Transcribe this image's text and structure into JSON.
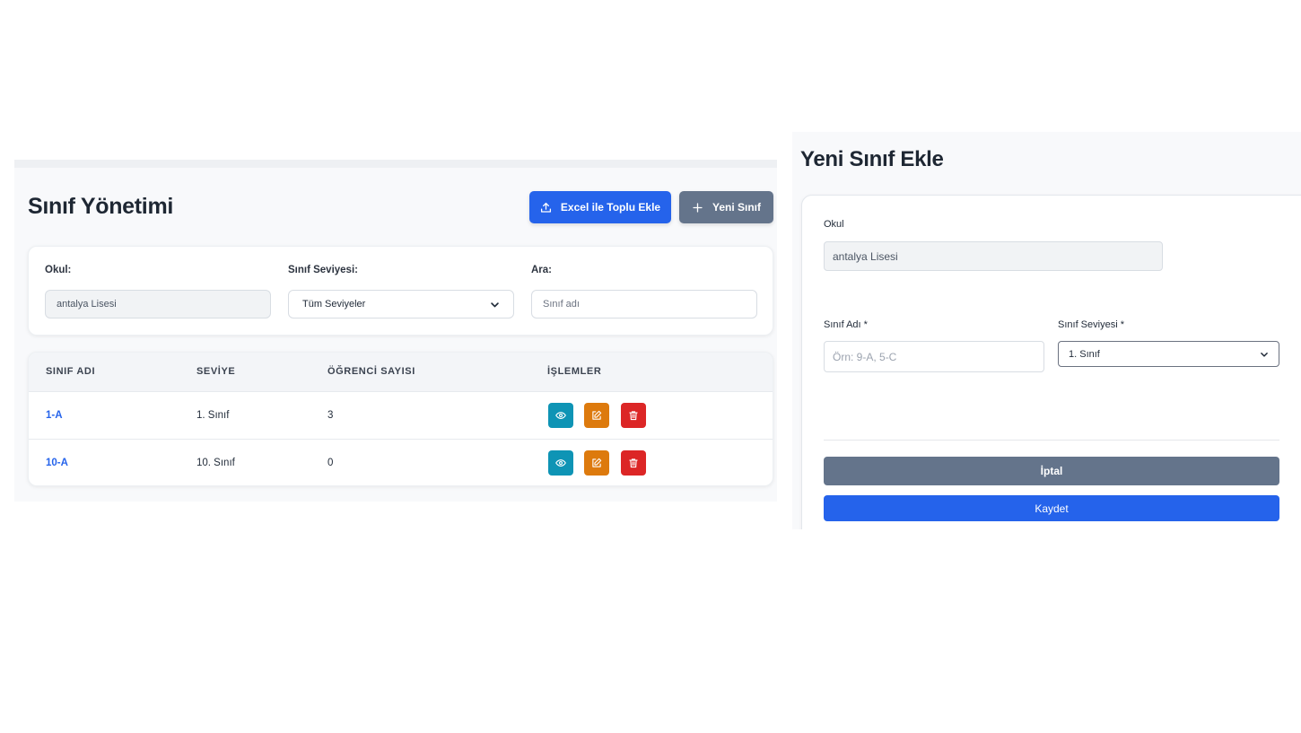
{
  "list_page": {
    "title": "Sınıf Yönetimi",
    "excel_button": "Excel ile Toplu Ekle",
    "new_button": "Yeni Sınıf",
    "filters": {
      "school_label": "Okul:",
      "school_value": "antalya Lisesi",
      "level_label": "Sınıf Seviyesi:",
      "level_value": "Tüm Seviyeler",
      "search_label": "Ara:",
      "search_placeholder": "Sınıf adı"
    },
    "table": {
      "headers": [
        "SINIF ADI",
        "SEVİYE",
        "ÖĞRENCİ SAYISI",
        "İŞLEMLER"
      ],
      "rows": [
        {
          "name": "1-A",
          "level": "1. Sınıf",
          "students": "3"
        },
        {
          "name": "10-A",
          "level": "10. Sınıf",
          "students": "0"
        }
      ]
    }
  },
  "modal": {
    "title": "Yeni Sınıf Ekle",
    "school_label": "Okul",
    "school_value": "antalya Lisesi",
    "name_label": "Sınıf Adı *",
    "name_placeholder": "Örn: 9-A, 5-C",
    "level_label": "Sınıf Seviyesi *",
    "level_value": "1. Sınıf",
    "cancel_button": "İptal",
    "save_button": "Kaydet"
  },
  "colors": {
    "primary": "#2563eb",
    "secondary": "#64748b",
    "view": "#0e94b5",
    "edit": "#dd7a0d",
    "delete": "#dc2626"
  }
}
